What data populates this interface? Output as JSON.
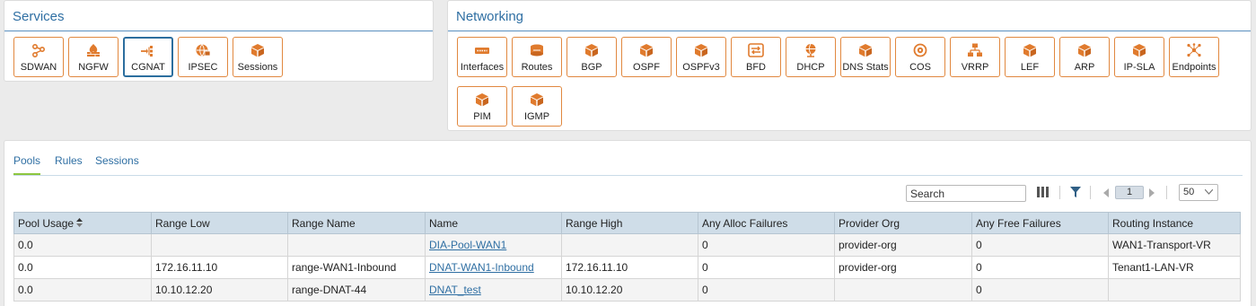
{
  "services": {
    "title": "Services",
    "tiles": [
      {
        "label": "SDWAN",
        "icon": "sdwan-icon"
      },
      {
        "label": "NGFW",
        "icon": "firewall-icon"
      },
      {
        "label": "CGNAT",
        "icon": "cgnat-icon",
        "selected": true
      },
      {
        "label": "IPSEC",
        "icon": "ipsec-icon"
      },
      {
        "label": "Sessions",
        "icon": "cube-icon"
      }
    ]
  },
  "networking": {
    "title": "Networking",
    "tiles": [
      {
        "label": "Interfaces",
        "icon": "interfaces-icon"
      },
      {
        "label": "Routes",
        "icon": "router-icon"
      },
      {
        "label": "BGP",
        "icon": "cube-icon"
      },
      {
        "label": "OSPF",
        "icon": "cube-icon"
      },
      {
        "label": "OSPFv3",
        "icon": "cube-icon"
      },
      {
        "label": "BFD",
        "icon": "bfd-icon"
      },
      {
        "label": "DHCP",
        "icon": "dhcp-icon"
      },
      {
        "label": "DNS Stats",
        "icon": "cube-icon"
      },
      {
        "label": "COS",
        "icon": "cos-icon"
      },
      {
        "label": "VRRP",
        "icon": "vrrp-icon"
      },
      {
        "label": "LEF",
        "icon": "cube-icon"
      },
      {
        "label": "ARP",
        "icon": "cube-icon"
      },
      {
        "label": "IP-SLA",
        "icon": "cube-icon"
      },
      {
        "label": "Endpoints",
        "icon": "endpoints-icon"
      },
      {
        "label": "PIM",
        "icon": "cube-icon"
      },
      {
        "label": "IGMP",
        "icon": "cube-icon"
      }
    ]
  },
  "tabs": [
    "Pools",
    "Rules",
    "Sessions"
  ],
  "active_tab": "Pools",
  "toolbar": {
    "search_placeholder": "Search",
    "page": "1",
    "page_size": "50"
  },
  "table": {
    "columns": [
      "Pool Usage",
      "Range Low",
      "Range Name",
      "Name",
      "Range High",
      "Any Alloc Failures",
      "Provider Org",
      "Any Free Failures",
      "Routing Instance"
    ],
    "rows": [
      [
        "0.0",
        "",
        "",
        "DIA-Pool-WAN1",
        "",
        "0",
        "provider-org",
        "0",
        "WAN1-Transport-VR"
      ],
      [
        "0.0",
        "172.16.11.10",
        "range-WAN1-Inbound",
        "DNAT-WAN1-Inbound",
        "172.16.11.10",
        "0",
        "provider-org",
        "0",
        "Tenant1-LAN-VR"
      ],
      [
        "0.0",
        "10.10.12.20",
        "range-DNAT-44",
        "DNAT_test",
        "10.10.12.20",
        "0",
        "",
        "0",
        ""
      ]
    ]
  },
  "colors": {
    "accent": "#2f6fa3",
    "tile_border": "#e1883f",
    "icon": "#e07b2e",
    "tab_active": "#8dc63f"
  }
}
